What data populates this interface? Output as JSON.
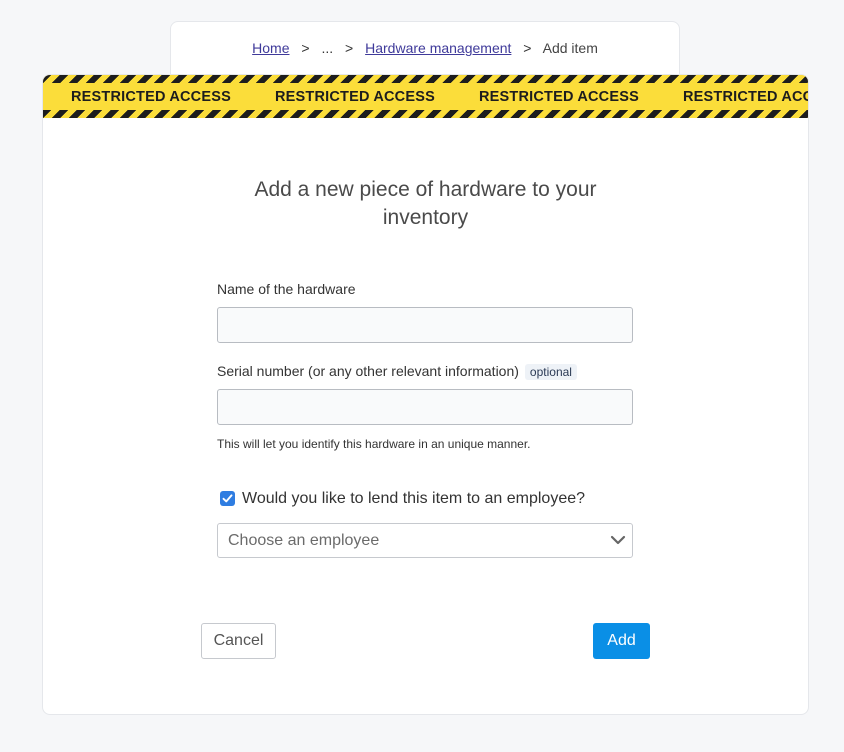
{
  "breadcrumb": {
    "home": "Home",
    "sep1": ">",
    "ellipsis": "...",
    "sep2": ">",
    "hardware": "Hardware management",
    "sep3": ">",
    "current": "Add item"
  },
  "banner": {
    "text": "RESTRICTED ACCESS",
    "stripe_dark": "#1d1d1d",
    "stripe_yellow": "#fbdd3a"
  },
  "form": {
    "title": "Add a new piece of hardware to your inventory",
    "name_label": "Name of the hardware",
    "name_value": "",
    "serial_label": "Serial number (or any other relevant information)",
    "optional_badge": "optional",
    "serial_value": "",
    "serial_help": "This will let you identify this hardware in an unique manner.",
    "lend_checkbox_label": "Would you like to lend this item to an employee?",
    "lend_checked": true,
    "employee_select_value": "Choose an employee",
    "cancel_label": "Cancel",
    "add_label": "Add"
  },
  "colors": {
    "accent": "#0a8fe6",
    "checkbox": "#2f7de1",
    "link": "#3f3a9a"
  },
  "icons": {
    "checkbox": "check-icon",
    "select": "chevron-down-icon"
  }
}
